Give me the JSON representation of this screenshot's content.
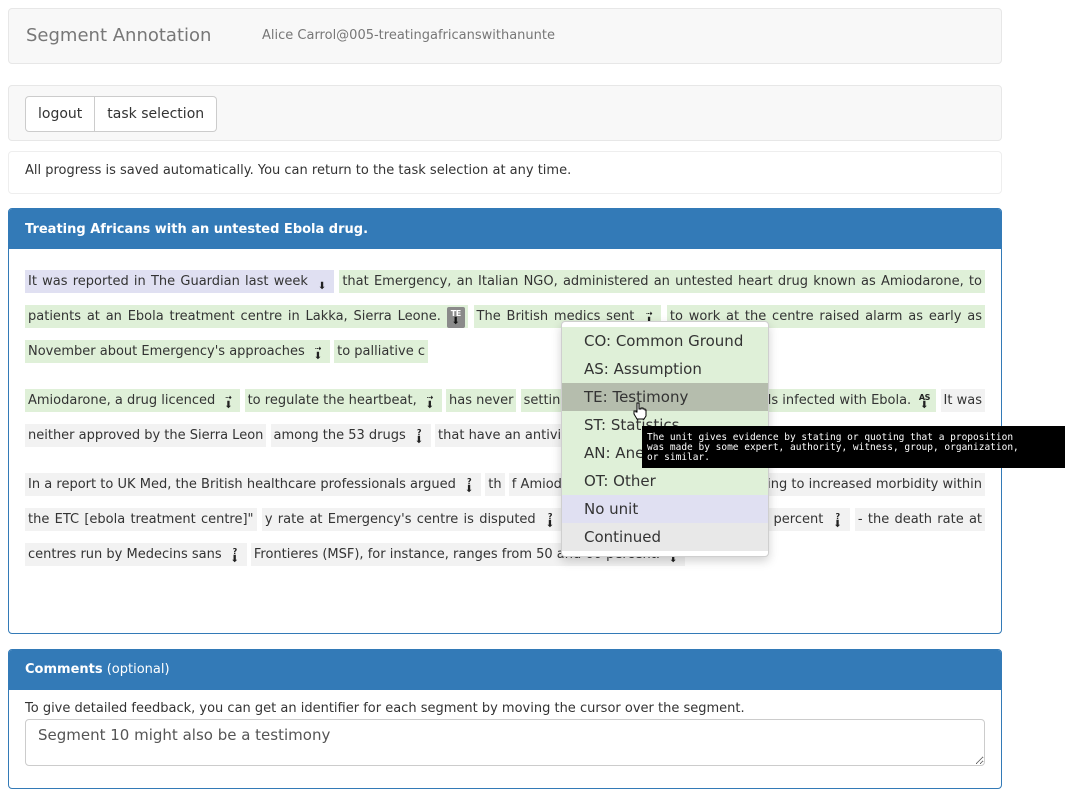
{
  "app": {
    "title": "Segment Annotation",
    "user": "Alice Carrol@005-treatingafricanswithanunte"
  },
  "nav": {
    "logout": "logout",
    "task_selection": "task selection"
  },
  "notice": "All progress is saved automatically. You can return to the task selection at any time.",
  "document": {
    "title": "Treating Africans with an untested Ebola drug.",
    "paragraphs": [
      [
        {
          "text": "It was reported in The Guardian last week",
          "color": "purple"
        },
        {
          "text": "that Emergency, an Italian NGO, administered an untested heart drug known as Amiodarone, to patients at an Ebola treatment centre in Lakka, Sierra Leone.",
          "color": "green"
        },
        {
          "text": "The British medics sent",
          "color": "green"
        },
        {
          "text": "to work at the centre raised alarm as early as November about Emergency's approaches",
          "color": "green"
        },
        {
          "text": "to palliative c",
          "color": "green"
        }
      ],
      [
        {
          "text": "Amiodarone, a drug licenced",
          "color": "green"
        },
        {
          "text": "to regulate the heartbeat,",
          "color": "green"
        },
        {
          "text": "has never",
          "color": "green"
        },
        {
          "text": "setting",
          "color": "green"
        },
        {
          "text": "to treat humans or animals infected with Ebola.",
          "color": "green"
        },
        {
          "text": "It was neither approved by the Sierra Leon",
          "color": "grey"
        },
        {
          "text": "among the 53 drugs",
          "color": "grey"
        },
        {
          "text": "that have an antiviral effect on Ebola.",
          "color": "grey"
        }
      ],
      [
        {
          "text": "In a report to UK Med, the British healthcare professionals argued",
          "color": "grey"
        },
        {
          "text": "th",
          "color": "grey"
        },
        {
          "text": "f Amiodarone could in fact be contributing to increased morbidity within the ETC [ebola treatment centre]\"",
          "color": "grey"
        },
        {
          "text": "y rate at Emergency's centre is disputed",
          "color": "grey"
        },
        {
          "text": "-",
          "color": "grey"
        },
        {
          "text": "ranging from 58 and 67 percent",
          "color": "grey"
        },
        {
          "text": "- the death rate at centres run by Medecins sans",
          "color": "grey"
        },
        {
          "text": "Frontieres (MSF), for instance, ranges from 50 and 60 percent.",
          "color": "grey"
        }
      ]
    ],
    "markers": {
      "te": "TE",
      "as": "AS",
      "q": "?",
      "arrow": "⇢"
    }
  },
  "dropdown": {
    "options": [
      "CO: Common Ground",
      "AS: Assumption",
      "TE: Testimony",
      "ST: Statistics",
      "AN: Anecdote",
      "OT: Other",
      "No unit",
      "Continued"
    ],
    "hovered": "TE: Testimony",
    "tooltip": "The unit gives evidence by stating or quoting that a proposition\nwas made by some expert, authority, witness, group, organization,\nor similar."
  },
  "comments": {
    "heading": "Comments",
    "optional": "(optional)",
    "help": "To give detailed feedback, you can get an identifier for each segment by moving the cursor over the segment.",
    "value": "Segment 10 might also be a testimony"
  },
  "colors": {
    "primary": "#337ab7",
    "segment_green": "#dff0d8",
    "segment_purple": "#e0e0f2",
    "segment_grey": "#f2f2f2"
  }
}
